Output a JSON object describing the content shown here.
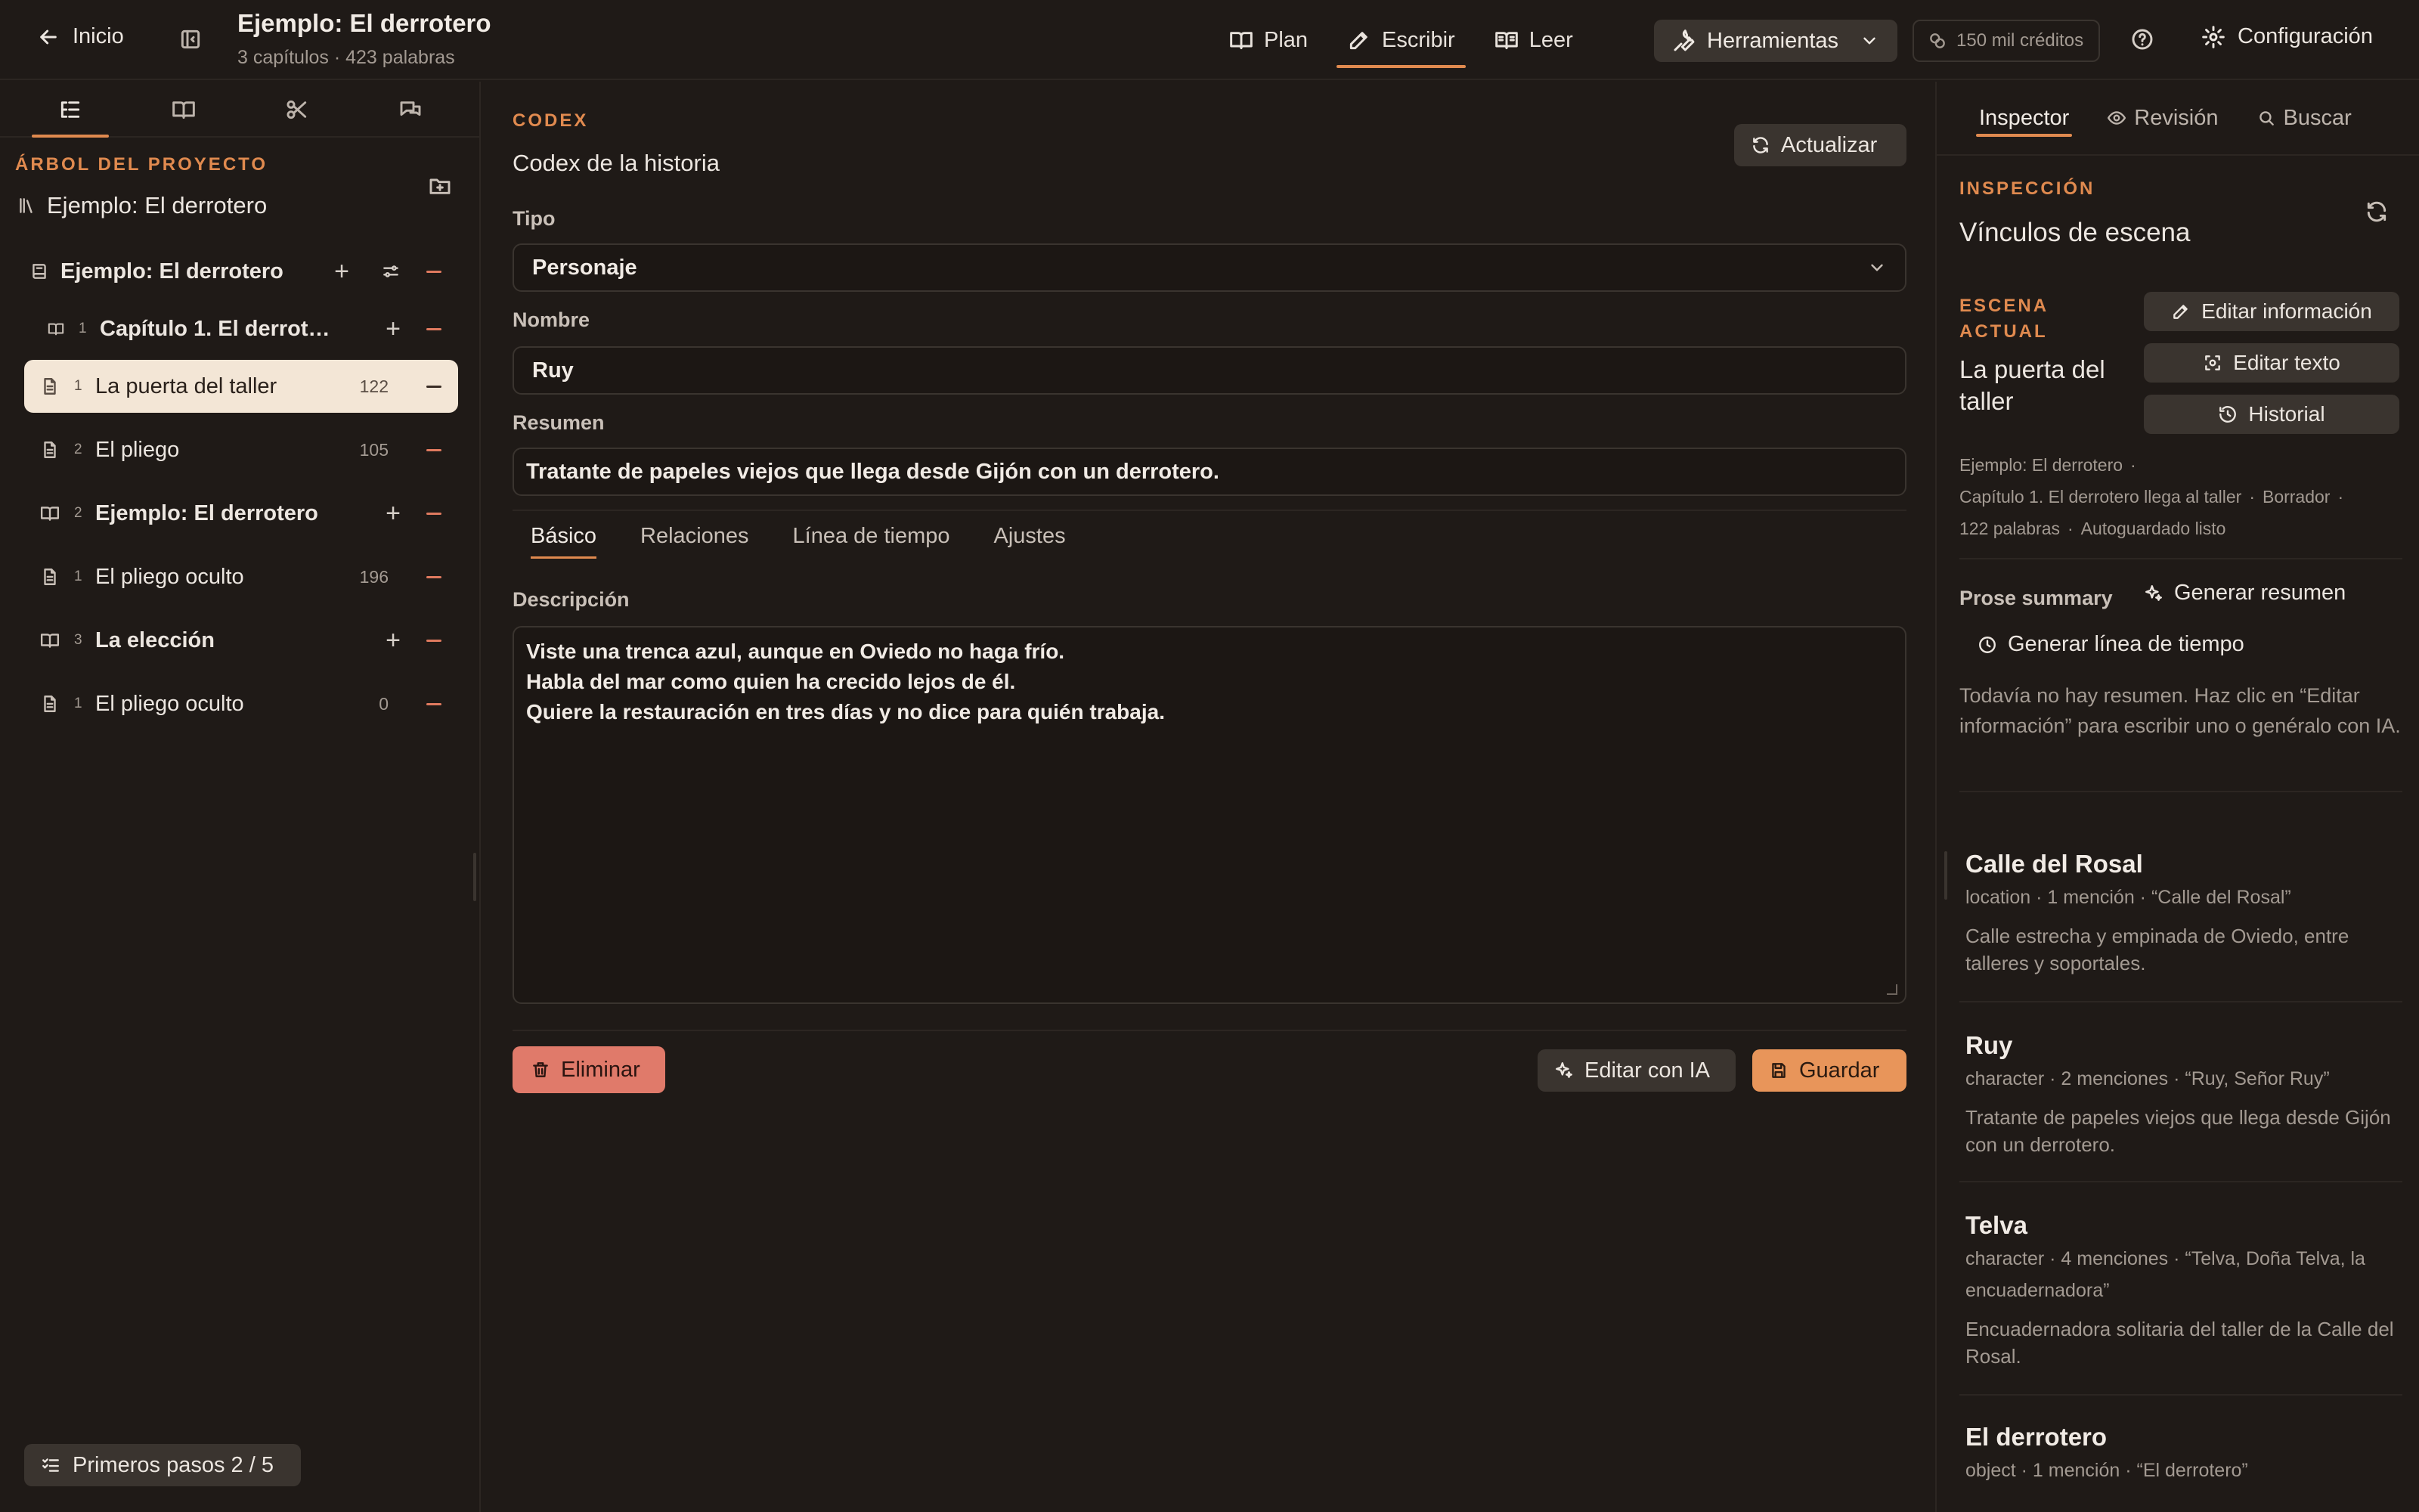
{
  "topbar": {
    "back_label": "Inicio",
    "project_title": "Ejemplo: El derrotero",
    "project_subtitle": "3 capítulos · 423 palabras",
    "modes": [
      {
        "label": "Plan",
        "icon": "book-open-icon"
      },
      {
        "label": "Escribir",
        "icon": "pencil-icon",
        "active": true
      },
      {
        "label": "Leer",
        "icon": "book-read-icon"
      }
    ],
    "tools_label": "Herramientas",
    "credits_label": "150 mil créditos",
    "settings_label": "Configuración"
  },
  "sidebar": {
    "tabs": [
      "tree-icon",
      "book-icon",
      "scissors-icon",
      "chat-icon"
    ],
    "section_label": "ÁRBOL DEL PROYECTO",
    "root_title": "Ejemplo: El derrotero",
    "tree": [
      {
        "level": "book",
        "label": "Ejemplo: El derrotero"
      },
      {
        "level": "chapter",
        "num": "1",
        "label": "Capítulo 1. El derrotero llega al taller"
      },
      {
        "level": "scene",
        "num": "1",
        "label": "La puerta del taller",
        "count": "122",
        "selected": true
      },
      {
        "level": "scene",
        "num": "2",
        "label": "El pliego",
        "count": "105"
      },
      {
        "level": "chapter",
        "num": "2",
        "label": "Ejemplo: El derrotero"
      },
      {
        "level": "scene",
        "num": "1",
        "label": "El pliego oculto",
        "count": "196"
      },
      {
        "level": "chapter",
        "num": "3",
        "label": "La elección"
      },
      {
        "level": "scene",
        "num": "1",
        "label": "El pliego oculto",
        "count": "0"
      }
    ],
    "steps_label": "Primeros pasos 2 / 5"
  },
  "main": {
    "section_label": "CODEX",
    "title": "Codex de la historia",
    "refresh_label": "Actualizar",
    "type_label": "Tipo",
    "type_value": "Personaje",
    "name_label": "Nombre",
    "name_value": "Ruy",
    "summary_label": "Resumen",
    "summary_value": "Tratante de papeles viejos que llega desde Gijón con un derrotero.",
    "tabs": [
      "Básico",
      "Relaciones",
      "Línea de tiempo",
      "Ajustes"
    ],
    "description_label": "Descripción",
    "description_lines": [
      "Viste una trenca azul, aunque en Oviedo no haga frío.",
      "Habla del mar como quien ha crecido lejos de él.",
      "Quiere la restauración en tres días y no dice para quién trabaja."
    ],
    "delete_label": "Eliminar",
    "ai_edit_label": "Editar con IA",
    "save_label": "Guardar"
  },
  "inspector": {
    "tabs": [
      "Inspector",
      "Revisión",
      "Buscar"
    ],
    "section_label": "INSPECCIÓN",
    "title": "Vínculos de escena",
    "scene_label": "ESCENA ACTUAL",
    "scene_title": "La puerta del taller",
    "edit_info_label": "Editar información",
    "edit_text_label": "Editar texto",
    "history_label": "Historial",
    "meta": {
      "book": "Ejemplo: El derrotero",
      "chapter": "Capítulo 1. El derrotero llega al taller",
      "status": "Borrador",
      "words": "122 palabras",
      "autosave": "Autoguardado listo"
    },
    "prose_label": "Prose summary",
    "gen_summary_label": "Generar resumen",
    "gen_timeline_label": "Generar línea de tiempo",
    "no_summary": "Todavía no hay resumen. Haz clic en “Editar información” para escribir uno o genéralo con IA.",
    "entries": [
      {
        "name": "Calle del Rosal",
        "meta": "location · 1 mención · “Calle del Rosal”",
        "desc": "Calle estrecha y empinada de Oviedo, entre talleres y soportales."
      },
      {
        "name": "Ruy",
        "meta": "character · 2 menciones · “Ruy, Señor Ruy”",
        "desc": "Tratante de papeles viejos que llega desde Gijón con un derrotero."
      },
      {
        "name": "Telva",
        "meta": "character · 4 menciones · “Telva, Doña Telva, la encuadernadora”",
        "desc": "Encuadernadora solitaria del taller de la Calle del Rosal."
      },
      {
        "name": "El derrotero",
        "meta": "object · 1 mención · “El derrotero”",
        "desc": ""
      }
    ]
  },
  "colors": {
    "accent": "#e08a4f",
    "background": "#1f1a17",
    "danger": "#e07a6a",
    "selected_row": "#f3e6d6"
  }
}
